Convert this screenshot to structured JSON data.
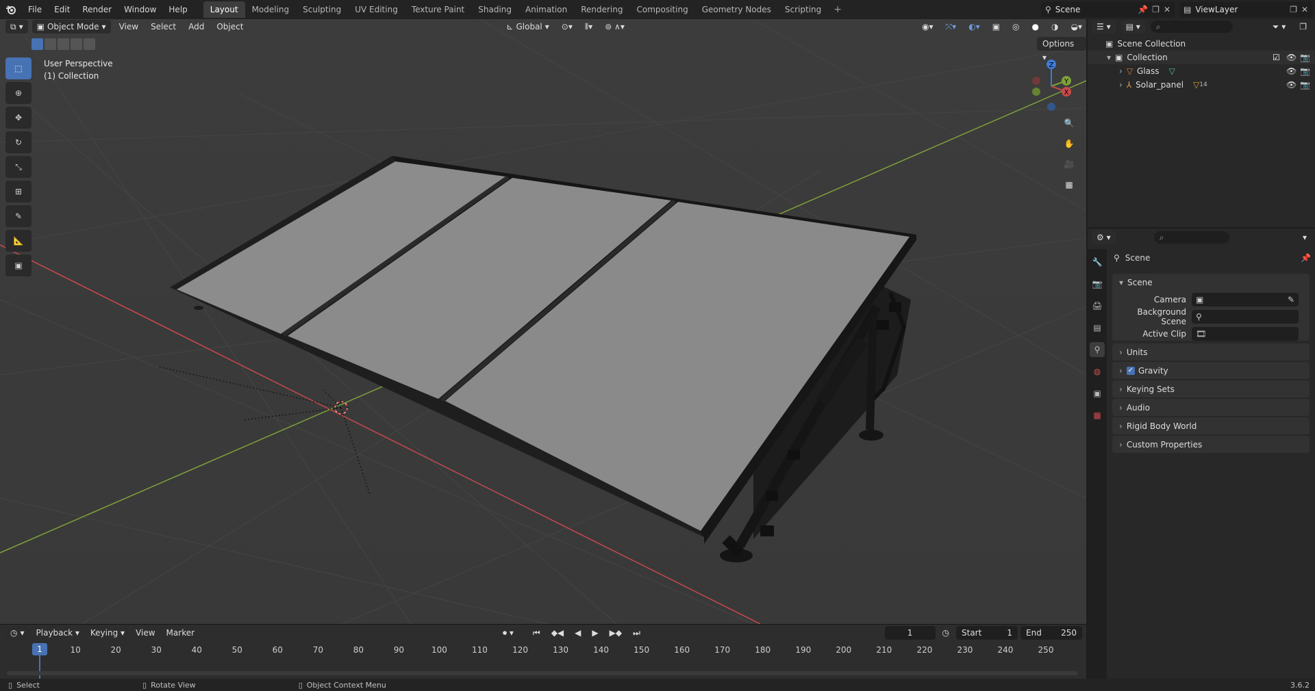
{
  "topbar": {
    "menus": [
      "File",
      "Edit",
      "Render",
      "Window",
      "Help"
    ],
    "workspaces": [
      "Layout",
      "Modeling",
      "Sculpting",
      "UV Editing",
      "Texture Paint",
      "Shading",
      "Animation",
      "Rendering",
      "Compositing",
      "Geometry Nodes",
      "Scripting"
    ],
    "active_workspace": "Layout",
    "scene_name": "Scene",
    "view_layer": "ViewLayer"
  },
  "viewport": {
    "mode": "Object Mode",
    "menus": [
      "View",
      "Select",
      "Add",
      "Object"
    ],
    "transform_orientation": "Global",
    "options_label": "Options",
    "perspective_label": "User Perspective",
    "collection_label": "(1) Collection",
    "gizmo_axes": {
      "x": "X",
      "y": "Y",
      "z": "Z"
    }
  },
  "timeline": {
    "menus": [
      "Playback",
      "Keying",
      "View",
      "Marker"
    ],
    "current_frame": "1",
    "start_label": "Start",
    "start_value": "1",
    "end_label": "End",
    "end_value": "250",
    "ruler_ticks": [
      "1",
      "10",
      "20",
      "30",
      "40",
      "50",
      "60",
      "70",
      "80",
      "90",
      "100",
      "110",
      "120",
      "130",
      "140",
      "150",
      "160",
      "170",
      "180",
      "190",
      "200",
      "210",
      "220",
      "230",
      "240",
      "250"
    ]
  },
  "status": {
    "select": "Select",
    "rotate": "Rotate View",
    "context": "Object Context Menu",
    "version": "3.6.2"
  },
  "outliner": {
    "scene_collection": "Scene Collection",
    "collection": "Collection",
    "items": [
      {
        "name": "Glass",
        "color": "#e07a3a"
      },
      {
        "name": "Solar_panel",
        "color": "#e0a040",
        "badge": "14"
      }
    ]
  },
  "properties": {
    "context_title": "Scene",
    "panel_title": "Scene",
    "fields": [
      {
        "label": "Camera"
      },
      {
        "label": "Background Scene"
      },
      {
        "label": "Active Clip"
      }
    ],
    "sections": [
      {
        "label": "Units",
        "checkbox": false
      },
      {
        "label": "Gravity",
        "checkbox": true
      },
      {
        "label": "Keying Sets",
        "checkbox": false
      },
      {
        "label": "Audio",
        "checkbox": false
      },
      {
        "label": "Rigid Body World",
        "checkbox": false
      },
      {
        "label": "Custom Properties",
        "checkbox": false
      }
    ]
  },
  "colors": {
    "accent": "#4772b3",
    "x_axis": "#c94a4a",
    "y_axis": "#7fa13a",
    "z_axis": "#3e7bd6"
  }
}
